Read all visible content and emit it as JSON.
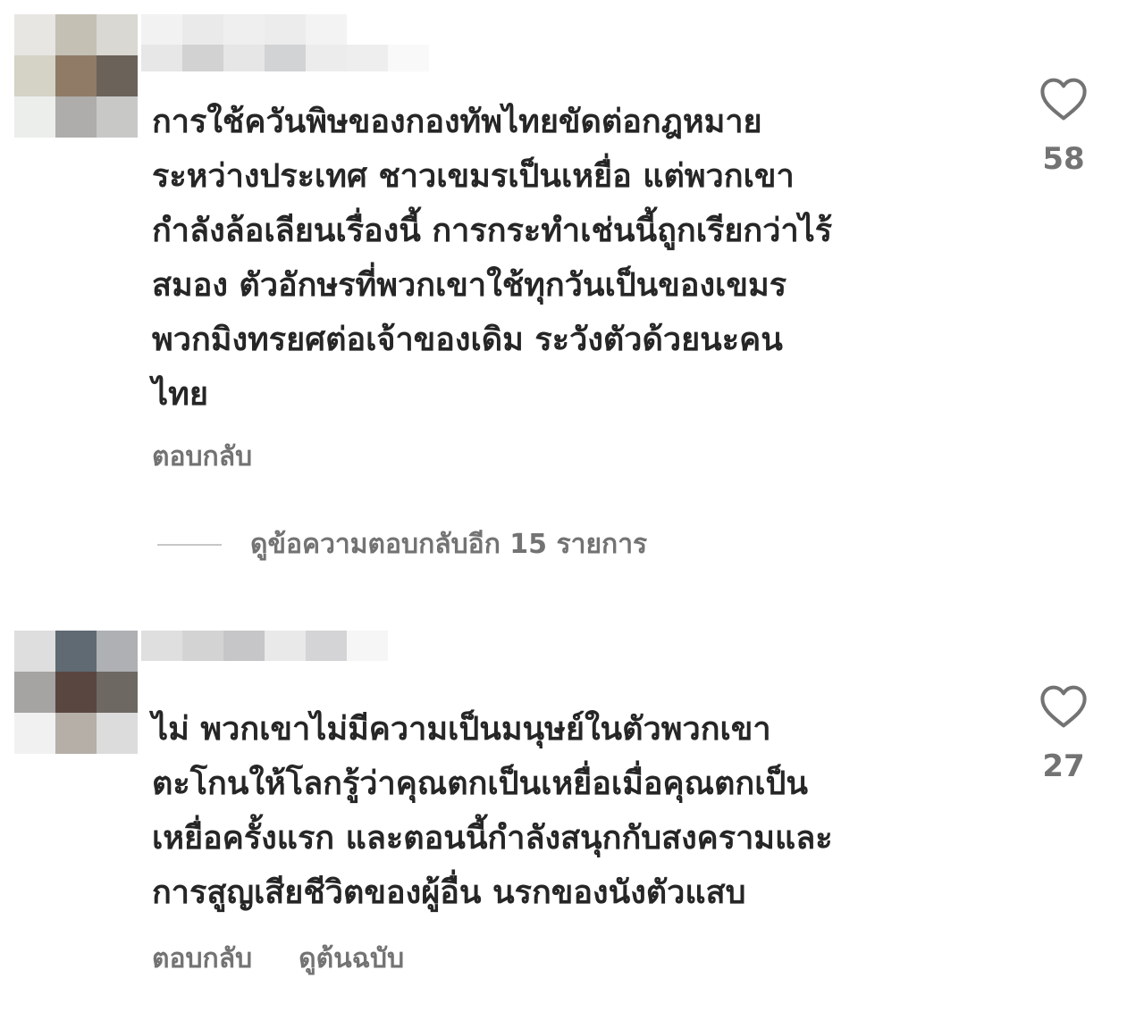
{
  "comments": [
    {
      "text": "การใช้ควันพิษของกองทัพไทยขัดต่อกฎหมาย\nระหว่างประเทศ ชาวเขมรเป็นเหยื่อ แต่พวกเขา\nกำลังล้อเลียนเรื่องนี้ การกระทำเช่นนี้ถูกเรียกว่าไร้\nสมอง ตัวอักษรที่พวกเขาใช้ทุกวันเป็นของเขมร\nพวกมิงทรยศต่อเจ้าของเดิม ระวังตัวด้วยนะคน\nไทย",
      "likes": "58",
      "reply_label": "ตอบกลับ",
      "view_replies": "ดูข้อความตอบกลับอีก 15 รายการ",
      "avatar_colors": [
        "#e8e6e2",
        "#c4c0b4",
        "#d9d8d3",
        "#d4d3c6",
        "#8f7b66",
        "#6b6259",
        "#eceeec",
        "#aeadab",
        "#c8c8c7"
      ],
      "name_colors": [
        "#f2f2f2",
        "#eaeaea",
        "#efefef",
        "#ececec",
        "#f3f3f3",
        "#ffffff",
        "#ffffff",
        "#e7e7e8",
        "#d2d2d3",
        "#e6e6e7",
        "#d2d3d4",
        "#ececec",
        "#eeeeee",
        "#f9f9f9"
      ]
    },
    {
      "text": "ไม่ พวกเขาไม่มีความเป็นมนุษย์ในตัวพวกเขา\nตะโกนให้โลกรู้ว่าคุณตกเป็นเหยื่อเมื่อคุณตกเป็น\nเหยื่อครั้งแรก และตอนนี้กำลังสนุกกับสงครามและ\nการสูญเสียชีวิตของผู้อื่น นรกของนังตัวแสบ",
      "likes": "27",
      "reply_label": "ตอบกลับ",
      "see_original": "ดูต้นฉบับ",
      "avatar_colors": [
        "#dedede",
        "#5f6a73",
        "#aeb0b3",
        "#a6a4a2",
        "#5a4640",
        "#6e6863",
        "#f1f1f1",
        "#b5afa8",
        "#dcdcdc"
      ],
      "name_colors": [
        "#dfdfe0",
        "#d3d3d4",
        "#c6c6c8",
        "#e9e9ea",
        "#d4d4d6",
        "#f6f6f6",
        "#ffffff",
        "#ffffff",
        "#ffffff",
        "#ffffff",
        "#ffffff",
        "#ffffff",
        "#ffffff",
        "#ffffff"
      ]
    }
  ],
  "icons": {
    "like": "heart-outline-icon"
  },
  "colors": {
    "text": "#262626",
    "secondary": "#737373",
    "divider": "#c7c7c7"
  }
}
